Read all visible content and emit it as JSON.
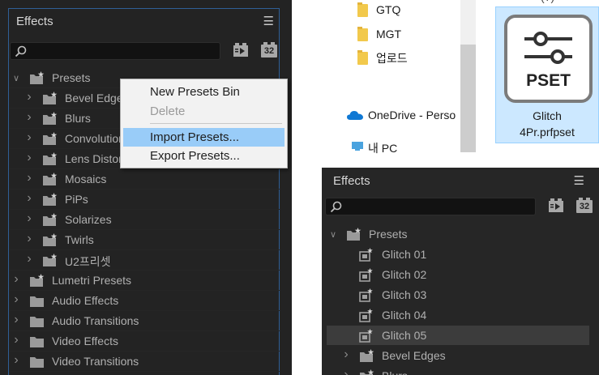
{
  "left_panel": {
    "title": "Effects",
    "menu_icon": "hamburger-menu-icon",
    "toolbar": {
      "accelerated_icon": "accelerated-effects-icon",
      "bit32_label": "32"
    },
    "items": [
      {
        "label": "Presets",
        "level": 0,
        "expanded": true,
        "icon": "preset-bin-icon"
      },
      {
        "label": "Bevel Edges",
        "level": 1,
        "expanded": false,
        "icon": "preset-bin-icon"
      },
      {
        "label": "Blurs",
        "level": 1,
        "expanded": false,
        "icon": "preset-bin-icon"
      },
      {
        "label": "Convolution",
        "level": 1,
        "expanded": false,
        "icon": "preset-bin-icon"
      },
      {
        "label": "Lens Distortion",
        "level": 1,
        "expanded": false,
        "icon": "preset-bin-icon"
      },
      {
        "label": "Mosaics",
        "level": 1,
        "expanded": false,
        "icon": "preset-bin-icon"
      },
      {
        "label": "PiPs",
        "level": 1,
        "expanded": false,
        "icon": "preset-bin-icon"
      },
      {
        "label": "Solarizes",
        "level": 1,
        "expanded": false,
        "icon": "preset-bin-icon"
      },
      {
        "label": "Twirls",
        "level": 1,
        "expanded": false,
        "icon": "preset-bin-icon"
      },
      {
        "label": "U2프리셋",
        "level": 1,
        "expanded": false,
        "icon": "preset-bin-icon"
      },
      {
        "label": "Lumetri Presets",
        "level": 0,
        "expanded": false,
        "icon": "preset-bin-icon"
      },
      {
        "label": "Audio Effects",
        "level": 0,
        "expanded": false,
        "icon": "folder-icon"
      },
      {
        "label": "Audio Transitions",
        "level": 0,
        "expanded": false,
        "icon": "folder-icon"
      },
      {
        "label": "Video Effects",
        "level": 0,
        "expanded": false,
        "icon": "folder-icon"
      },
      {
        "label": "Video Transitions",
        "level": 0,
        "expanded": false,
        "icon": "folder-icon"
      }
    ]
  },
  "context_menu": {
    "items": [
      {
        "label": "New Presets Bin",
        "disabled": false,
        "highlighted": false
      },
      {
        "label": "Delete",
        "disabled": true,
        "highlighted": false
      },
      {
        "label": "Import Presets...",
        "disabled": false,
        "highlighted": true
      },
      {
        "label": "Export Presets...",
        "disabled": false,
        "highlighted": false
      }
    ]
  },
  "explorer": {
    "folders": [
      "GTQ",
      "MGT",
      "업로드"
    ],
    "onedrive_label": "OneDrive - Perso",
    "pc_label": "내 PC",
    "file": {
      "icon_label": "PSET",
      "name_line1": "Glitch",
      "name_line2": "4Pr.prfpset",
      "partial_top": "(?)"
    }
  },
  "right_panel": {
    "title": "Effects",
    "toolbar": {
      "bit32_label": "32"
    },
    "items": [
      {
        "label": "Presets",
        "level": 0,
        "expanded": true,
        "icon": "preset-bin-icon",
        "selected": false
      },
      {
        "label": "Glitch 01",
        "level": 1,
        "icon": "preset-icon",
        "selected": false
      },
      {
        "label": "Glitch 02",
        "level": 1,
        "icon": "preset-icon",
        "selected": false
      },
      {
        "label": "Glitch 03",
        "level": 1,
        "icon": "preset-icon",
        "selected": false
      },
      {
        "label": "Glitch 04",
        "level": 1,
        "icon": "preset-icon",
        "selected": false
      },
      {
        "label": "Glitch 05",
        "level": 1,
        "icon": "preset-icon",
        "selected": true
      },
      {
        "label": "Bevel Edges",
        "level": 1,
        "expanded": false,
        "icon": "preset-bin-icon",
        "selected": false
      },
      {
        "label": "Blurs",
        "level": 1,
        "expanded": false,
        "icon": "preset-bin-icon",
        "selected": false
      }
    ]
  }
}
